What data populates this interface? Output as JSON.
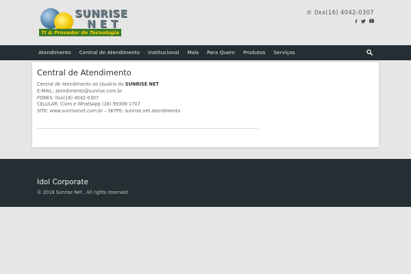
{
  "header": {
    "logo": {
      "brand_line1": "SUNRISE",
      "brand_line2": "NET",
      "tagline": "TI & Provedor de Tecnologia"
    },
    "phone": "0xx(16) 4042-0307",
    "phone_icon": "phone-icon",
    "social_icons": [
      "facebook-icon",
      "twitter-icon",
      "youtube-icon"
    ]
  },
  "nav": {
    "items": [
      "Atendimento",
      "Central de Atendimento",
      "Institucional",
      "Mais",
      "Para Quem",
      "Produtos",
      "Serviços"
    ],
    "search_icon": "search-icon"
  },
  "content": {
    "title": "Central de Atendimento",
    "intro_prefix": "Central de Atendimento ao Usuário da",
    "intro_brand": "SUNRISE NET",
    "email": "E-MAIL: atendimento@sunrise.com.br",
    "phones": "FONES: 0xx(16) 4042-0307",
    "mobile": "CELULAR: Claro e WhatsApp (16) 99306-1707",
    "site": "SITE: www.sunrisenet.com.br – SKYPE: sunrise.net.atendimento"
  },
  "footer": {
    "title": "Idol Corporate",
    "copyright": "© 2018 Sunrise Net , All rights reserved"
  },
  "colors": {
    "background": "#e6e6e6",
    "nav_bar": "#232f33",
    "footer": "#232f33",
    "card": "#ffffff"
  }
}
